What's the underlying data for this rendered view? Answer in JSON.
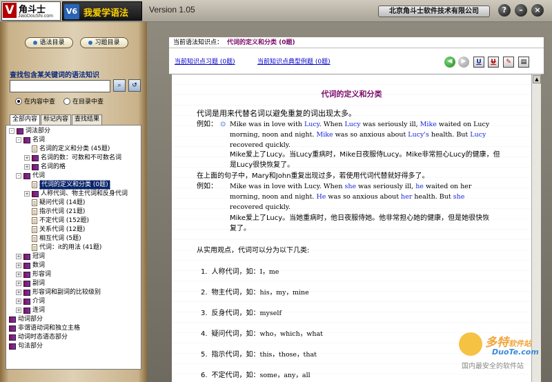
{
  "titlebar": {
    "logo_char": "V",
    "logo_name": "角斗士",
    "logo_site": "JiaoDouShi.com",
    "product_badge": "V6",
    "product_name": "我爱学语法",
    "version": "Version 1.05",
    "company": "北京角斗士软件技术有限公司",
    "buttons": [
      "?",
      "–",
      "×"
    ]
  },
  "sidebar": {
    "nav_buttons": [
      "语法目录",
      "习题目录"
    ],
    "search_title": "查找包含某关键词的语法知识",
    "search_value": "",
    "radio_options": [
      {
        "label": "在内容中查",
        "checked": true
      },
      {
        "label": "在目录中查",
        "checked": false
      }
    ],
    "tabs": [
      "全部内容",
      "标记内容",
      "查找结果"
    ],
    "active_tab": "全部内容",
    "tree": [
      {
        "label": "词法部分",
        "level": 0,
        "icon": "book-icon",
        "exp": "-"
      },
      {
        "label": "名词",
        "level": 1,
        "icon": "book-icon",
        "exp": "-"
      },
      {
        "label": "名词的定义和分类 (45题)",
        "level": 2,
        "icon": "page-icon",
        "exp": ""
      },
      {
        "label": "名词的数：可数和不可数名词",
        "level": 2,
        "icon": "book-icon",
        "exp": "+"
      },
      {
        "label": "名词的格",
        "level": 2,
        "icon": "book-icon",
        "exp": "+"
      },
      {
        "label": "代词",
        "level": 1,
        "icon": "book-icon",
        "exp": "-"
      },
      {
        "label": "代词的定义和分类 (0题)",
        "level": 2,
        "icon": "page-icon",
        "exp": "",
        "selected": true
      },
      {
        "label": "人称代词、物主代词和反身代词",
        "level": 2,
        "icon": "book-icon",
        "exp": "+"
      },
      {
        "label": "疑问代词 (14题)",
        "level": 2,
        "icon": "page-icon",
        "exp": ""
      },
      {
        "label": "指示代词 (21题)",
        "level": 2,
        "icon": "page-icon",
        "exp": ""
      },
      {
        "label": "不定代词 (152题)",
        "level": 2,
        "icon": "page-icon",
        "exp": ""
      },
      {
        "label": "关系代词 (12题)",
        "level": 2,
        "icon": "page-icon",
        "exp": ""
      },
      {
        "label": "相互代词 (5题)",
        "level": 2,
        "icon": "page-icon",
        "exp": ""
      },
      {
        "label": "代词：it的用法 (41题)",
        "level": 2,
        "icon": "page-icon",
        "exp": ""
      },
      {
        "label": "冠词",
        "level": 1,
        "icon": "book-icon",
        "exp": "+"
      },
      {
        "label": "数词",
        "level": 1,
        "icon": "book-icon",
        "exp": "+"
      },
      {
        "label": "形容词",
        "level": 1,
        "icon": "book-icon",
        "exp": "+"
      },
      {
        "label": "副词",
        "level": 1,
        "icon": "book-icon",
        "exp": "+"
      },
      {
        "label": "形容词和副词的比较级别",
        "level": 1,
        "icon": "book-icon",
        "exp": "+"
      },
      {
        "label": "介词",
        "level": 1,
        "icon": "book-icon",
        "exp": "+"
      },
      {
        "label": "连词",
        "level": 1,
        "icon": "book-icon",
        "exp": "+"
      },
      {
        "label": "动词部分",
        "level": 0,
        "icon": "book-icon",
        "exp": ""
      },
      {
        "label": "非谓语动词和独立主格",
        "level": 0,
        "icon": "book-icon",
        "exp": ""
      },
      {
        "label": "动词时态语态部分",
        "level": 0,
        "icon": "book-icon",
        "exp": ""
      },
      {
        "label": "句法部分",
        "level": 0,
        "icon": "book-icon",
        "exp": ""
      }
    ]
  },
  "main": {
    "knowledge_label": "当前语法知识点：",
    "knowledge_value": "代词的定义和分类 (0题)",
    "link_exercises": "当前知识点习题 (0题)",
    "link_examples": "当前知识点典型例题 (0题)",
    "tool_buttons": [
      "U",
      "U",
      "",
      "",
      ""
    ],
    "title": "代词的定义和分类",
    "intro": "代词是用来代替名词以避免重复的词出现太多。",
    "example_label": "例如：",
    "ex1": [
      [
        {
          "t": "Mike was in love with "
        },
        {
          "t": "Lucy",
          "h": true
        },
        {
          "t": ". When "
        },
        {
          "t": "Lucy",
          "h": true
        },
        {
          "t": " was seriously ill, "
        },
        {
          "t": "Mike",
          "h": true
        },
        {
          "t": " waited on Lucy"
        }
      ],
      [
        {
          "t": "morning, noon and night. "
        },
        {
          "t": "Mike",
          "h": true
        },
        {
          "t": " was so anxious about "
        },
        {
          "t": "Lucy's",
          "h": true
        },
        {
          "t": " health. But "
        },
        {
          "t": "Lucy",
          "h": true
        }
      ],
      [
        {
          "t": "recovered quickly."
        }
      ]
    ],
    "ex1_cn": [
      "Mike爱上了Lucy。当Lucy重病时，Mike日夜服侍Lucy。Mike非常担心Lucy的健康，但",
      "是Lucy很快恢复了。"
    ],
    "transition": "在上面的句子中，Mary和John重复出现过多，若使用代词代替就好得多了。",
    "ex2": [
      [
        {
          "t": "Mike was in love with Lucy. When "
        },
        {
          "t": "she",
          "h": true
        },
        {
          "t": " was seriously ill, "
        },
        {
          "t": "he",
          "h": true
        },
        {
          "t": " waited on her"
        }
      ],
      [
        {
          "t": "morning, noon and night. "
        },
        {
          "t": "He",
          "h": true
        },
        {
          "t": " was so anxious about "
        },
        {
          "t": "her",
          "h": true
        },
        {
          "t": " health. But "
        },
        {
          "t": "she",
          "h": true
        }
      ],
      [
        {
          "t": "recovered quickly."
        }
      ]
    ],
    "ex2_cn": [
      "Mike爱上了Lucy。当她重病时，他日夜服侍她。他非常担心她的健康，但是她很快恢",
      "复了。"
    ],
    "classification_intro": "从实用观点，代词可以分为以下几类:",
    "categories": [
      {
        "num": "1.",
        "name": "人称代词，如：",
        "examples": "I，me"
      },
      {
        "num": "2.",
        "name": "物主代词，如：",
        "examples": "his，my，mine"
      },
      {
        "num": "3.",
        "name": "反身代词，如：",
        "examples": "myself"
      },
      {
        "num": "4.",
        "name": "疑问代词，如：",
        "examples": "who，which，what"
      },
      {
        "num": "5.",
        "name": "指示代词，如：",
        "examples": "this，those，that"
      },
      {
        "num": "6.",
        "name": "不定代词，如：",
        "examples": "some，any，all"
      }
    ]
  },
  "watermark": {
    "line1": "多特",
    "line1_small": "软件站",
    "line2": "DuoTe.com",
    "line3": "国内最安全的软件站"
  }
}
